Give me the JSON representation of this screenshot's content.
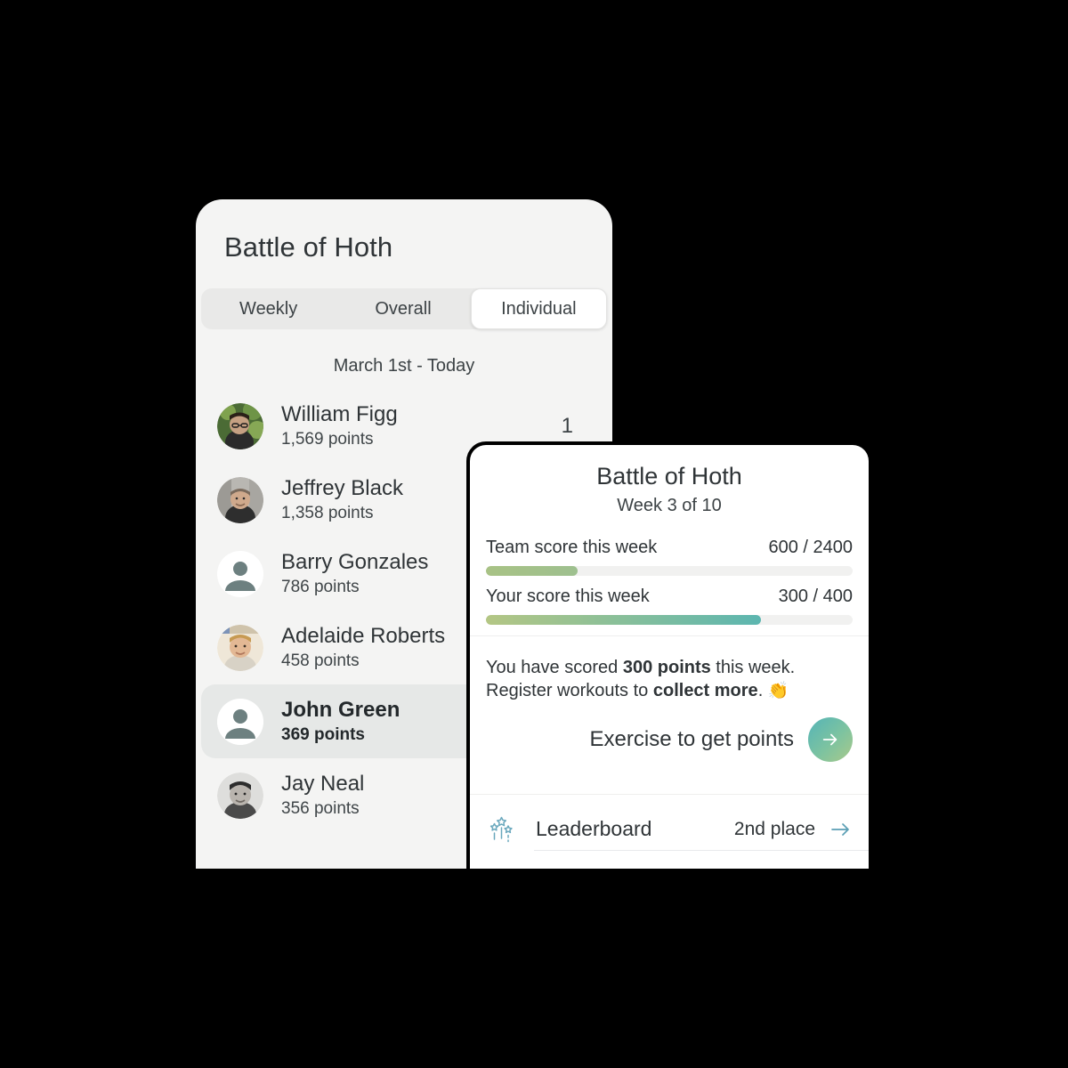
{
  "left_card": {
    "title": "Battle of Hoth",
    "tabs": [
      {
        "label": "Weekly",
        "active": false
      },
      {
        "label": "Overall",
        "active": false
      },
      {
        "label": "Individual",
        "active": true
      }
    ],
    "date_range": "March 1st - Today",
    "rows": [
      {
        "name": "William Figg",
        "points": "1,569 points",
        "rank": "1",
        "avatar": "photo-forest",
        "highlight": false
      },
      {
        "name": "Jeffrey Black",
        "points": "1,358 points",
        "rank": "",
        "avatar": "photo-street",
        "highlight": false
      },
      {
        "name": "Barry Gonzales",
        "points": "786 points",
        "rank": "",
        "avatar": "placeholder",
        "highlight": false
      },
      {
        "name": "Adelaide Roberts",
        "points": "458 points",
        "rank": "",
        "avatar": "photo-blond",
        "highlight": false
      },
      {
        "name": "John Green",
        "points": "369 points",
        "rank": "",
        "avatar": "placeholder",
        "highlight": true
      },
      {
        "name": "Jay Neal",
        "points": "356 points",
        "rank": "",
        "avatar": "photo-dark",
        "highlight": false
      }
    ]
  },
  "right_card": {
    "title": "Battle of Hoth",
    "subtitle": "Week 3 of 10",
    "team_score": {
      "label": "Team score this week",
      "value": "600 / 2400",
      "percent": 25
    },
    "your_score": {
      "label": "Your score this week",
      "value": "300 / 400",
      "percent": 75
    },
    "blurb": {
      "line1_pre": "You have scored ",
      "line1_bold": "300 points",
      "line1_post": " this week.",
      "line2_pre": "Register workouts to ",
      "line2_bold": "collect more",
      "line2_post": ".",
      "emoji": "👏"
    },
    "cta": {
      "label": "Exercise to get points",
      "icon": "arrow-right-icon"
    },
    "leaderboard": {
      "icon": "sparkler-stars-icon",
      "label": "Leaderboard",
      "place": "2nd place",
      "arrow": "arrow-right-icon"
    }
  },
  "colors": {
    "background": "#000000",
    "left_card_bg": "#f4f4f3",
    "right_card_bg": "#ffffff",
    "accent_teal": "#54b4b8",
    "accent_green": "#a9c98a",
    "highlight_row": "#e6e8e7",
    "text_primary": "#2f3437",
    "icon_teal": "#6aa8bd"
  }
}
